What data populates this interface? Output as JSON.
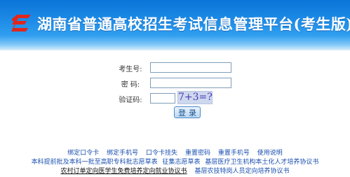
{
  "header": {
    "title": "湖南省普通高校招生考试信息管理平台(考生版)"
  },
  "form": {
    "exam_number_label": "考生号:",
    "password_label": "密  码:",
    "captcha_label": "验证码:",
    "exam_number_value": "",
    "password_value": "",
    "captcha_value": "",
    "captcha_text": "7+3=?",
    "login_label": "登录"
  },
  "links": {
    "row1": [
      "绑定口令卡",
      "绑定手机号",
      "口令卡挂失",
      "重置密码",
      "重置手机号",
      "使用说明"
    ],
    "row2": [
      "本科提前批及本科一批至高职专科批志愿草表",
      "征集志愿草表",
      "基层医疗卫生机构本土化人才培养协议书"
    ],
    "row3": [
      "农村订单定向医学生免费培养定向就业协议书",
      "基层农技特岗人员定向培养协议书"
    ]
  },
  "colors": {
    "header_top": "#0b74d8",
    "header_bottom": "#d9eefc",
    "link": "#1a4fb0",
    "logo_red": "#e0261c"
  }
}
